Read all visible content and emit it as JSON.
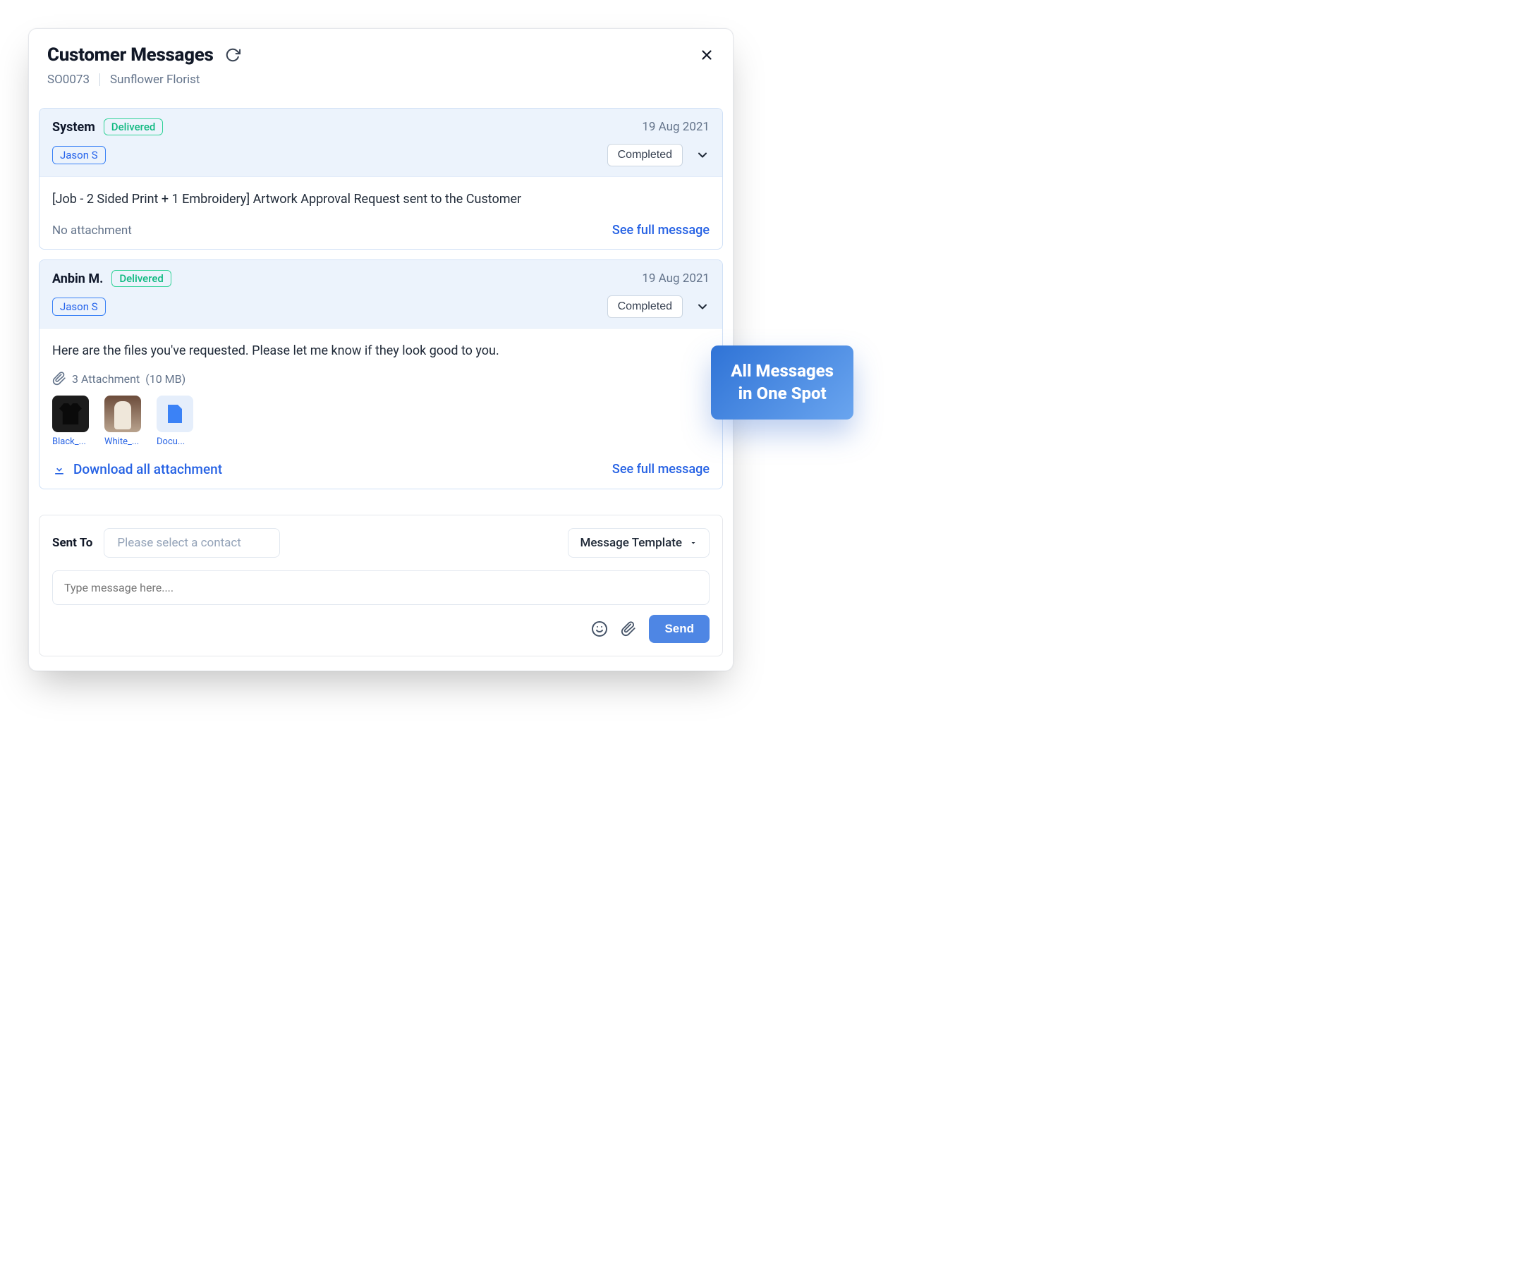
{
  "header": {
    "title": "Customer Messages",
    "order_id": "SO0073",
    "customer": "Sunflower Florist"
  },
  "messages": [
    {
      "sender": "System",
      "delivery_status": "Delivered",
      "date": "19 Aug 2021",
      "recipient": "Jason S",
      "stage": "Completed",
      "body": "[Job - 2 Sided Print + 1 Embroidery] Artwork Approval Request sent to the Customer",
      "attachment_note": "No attachment",
      "see_full": "See full message"
    },
    {
      "sender": "Anbin M.",
      "delivery_status": "Delivered",
      "date": "19 Aug 2021",
      "recipient": "Jason S",
      "stage": "Completed",
      "body": "Here are the files you've requested. Please let me know if they look good to you.",
      "attachments": {
        "count_label": "3 Attachment",
        "size_label": "(10 MB)",
        "items": [
          {
            "label": "Black_...",
            "kind": "shirt-dark"
          },
          {
            "label": "White_...",
            "kind": "photo"
          },
          {
            "label": "Docu...",
            "kind": "doc"
          }
        ],
        "download_all": "Download all attachment"
      },
      "see_full": "See full message"
    }
  ],
  "composer": {
    "sent_to_label": "Sent To",
    "contact_placeholder": "Please select a contact",
    "template_label": "Message Template",
    "input_placeholder": "Type message here....",
    "send_label": "Send"
  },
  "callout": "All Messages\nin One Spot"
}
